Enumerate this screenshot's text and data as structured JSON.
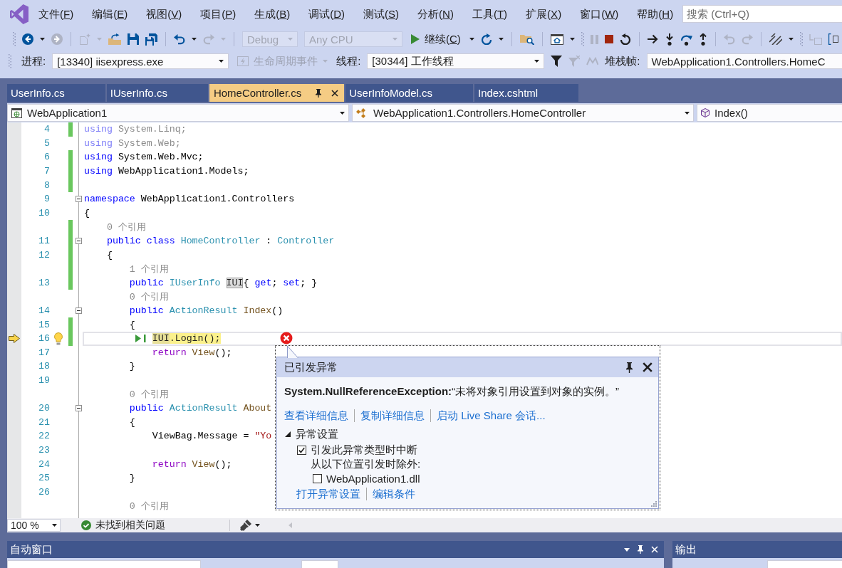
{
  "menu_bar": {
    "items": [
      {
        "prefix": "文件(",
        "access_key": "F",
        "suffix": ")"
      },
      {
        "prefix": "编辑(",
        "access_key": "E",
        "suffix": ")"
      },
      {
        "prefix": "视图(",
        "access_key": "V",
        "suffix": ")"
      },
      {
        "prefix": "项目(",
        "access_key": "P",
        "suffix": ")"
      },
      {
        "prefix": "生成(",
        "access_key": "B",
        "suffix": ")"
      },
      {
        "prefix": "调试(",
        "access_key": "D",
        "suffix": ")"
      },
      {
        "prefix": "测试(",
        "access_key": "S",
        "suffix": ")"
      },
      {
        "prefix": "分析(",
        "access_key": "N",
        "suffix": ")"
      },
      {
        "prefix": "工具(",
        "access_key": "T",
        "suffix": ")"
      },
      {
        "prefix": "扩展(",
        "access_key": "X",
        "suffix": ")"
      },
      {
        "prefix": "窗口(",
        "access_key": "W",
        "suffix": ")"
      },
      {
        "prefix": "帮助(",
        "access_key": "H",
        "suffix": ")"
      }
    ],
    "search": {
      "placeholder": "搜索 (Ctrl+Q)"
    }
  },
  "toolbar_1": {
    "items": [
      {
        "kind": "icon",
        "disabled": false
      },
      {
        "kind": "icon",
        "disabled": true
      },
      {
        "kind": "icon",
        "disabled": true
      },
      {
        "kind": "icon",
        "disabled": false
      },
      {
        "kind": "icon",
        "disabled": false
      },
      {
        "kind": "icon",
        "disabled": false
      },
      {
        "kind": "icon",
        "disabled": false
      },
      {
        "kind": "icon",
        "disabled": true
      },
      {
        "kind": "combo",
        "value": "Debug",
        "disabled": true
      },
      {
        "kind": "combo",
        "value": "Any CPU",
        "disabled": true
      },
      {
        "kind": "button",
        "prefix": "继续(",
        "access_key": "C",
        "suffix": ")"
      },
      {
        "kind": "icon",
        "disabled": false
      },
      {
        "kind": "icon",
        "disabled": false
      },
      {
        "kind": "icon",
        "disabled": false
      },
      {
        "kind": "icon",
        "disabled": true
      },
      {
        "kind": "icon",
        "disabled": false
      },
      {
        "kind": "icon",
        "disabled": false
      },
      {
        "kind": "icon",
        "disabled": false
      },
      {
        "kind": "icon",
        "disabled": false
      },
      {
        "kind": "icon",
        "disabled": false
      },
      {
        "kind": "icon",
        "disabled": false
      },
      {
        "kind": "icon",
        "disabled": true
      },
      {
        "kind": "icon",
        "disabled": true
      },
      {
        "kind": "icon",
        "disabled": false
      },
      {
        "kind": "icon",
        "disabled": true
      },
      {
        "kind": "icon",
        "disabled": false
      }
    ]
  },
  "toolbar_2": {
    "process_label": "进程:",
    "process": "[13340] iisexpress.exe",
    "lifecycle_events": {
      "label": "生命周期事件",
      "disabled": true
    },
    "thread_label": "线程:",
    "thread": "[30344] 工作线程",
    "thread_tools": [
      {
        "disabled": false
      },
      {
        "disabled": true
      },
      {
        "disabled": true
      }
    ],
    "stack_frame_label": "堆栈帧:",
    "stack_frame": "WebApplication1.Controllers.HomeC"
  },
  "tabs": [
    {
      "label": "UserInfo.cs",
      "selected": false
    },
    {
      "label": "IUserInfo.cs",
      "selected": false
    },
    {
      "label": "HomeController.cs",
      "selected": true
    },
    {
      "label": "UserInfoModel.cs",
      "selected": false
    },
    {
      "label": "Index.cshtml",
      "selected": false
    }
  ],
  "navigation_bar": {
    "project": "WebApplication1",
    "type": "WebApplication1.Controllers.HomeController",
    "member": "Index()"
  },
  "editor": {
    "lines": [
      {
        "kind": "code",
        "number": "4",
        "changed": true,
        "current": false,
        "tokens": [
          {
            "text": "using",
            "kind": "keyword_faded"
          },
          {
            "text": " System.Linq;",
            "kind": "faded"
          }
        ]
      },
      {
        "kind": "code",
        "number": "5",
        "changed": false,
        "current": false,
        "tokens": [
          {
            "text": "using",
            "kind": "keyword_faded"
          },
          {
            "text": " System.Web;",
            "kind": "faded"
          }
        ]
      },
      {
        "kind": "code",
        "number": "6",
        "changed": true,
        "current": false,
        "tokens": [
          {
            "text": "using",
            "kind": "keyword"
          },
          {
            "text": " System.Web.Mvc;",
            "kind": "plain"
          }
        ]
      },
      {
        "kind": "code",
        "number": "7",
        "changed": true,
        "current": false,
        "tokens": [
          {
            "text": "using",
            "kind": "keyword"
          },
          {
            "text": " WebApplication1.Models;",
            "kind": "plain"
          }
        ]
      },
      {
        "kind": "code",
        "number": "8",
        "changed": true,
        "current": false
      },
      {
        "kind": "code",
        "number": "9",
        "changed": false,
        "current": false,
        "expanded": true,
        "tokens": [
          {
            "text": "namespace",
            "kind": "keyword"
          },
          {
            "text": " WebApplication1.Controllers",
            "kind": "plain"
          }
        ]
      },
      {
        "kind": "code",
        "number": "10",
        "changed": false,
        "current": false,
        "tokens": [
          {
            "text": "{",
            "kind": "plain"
          }
        ]
      },
      {
        "kind": "codelens",
        "changed": true,
        "text": "    0 个引用"
      },
      {
        "kind": "code",
        "number": "11",
        "changed": true,
        "current": false,
        "expanded": true,
        "tokens": [
          {
            "text": "    public class",
            "kind": "keyword"
          },
          {
            "text": " HomeController",
            "kind": "type"
          },
          {
            "text": " : ",
            "kind": "plain"
          },
          {
            "text": "Controller",
            "kind": "type"
          }
        ]
      },
      {
        "kind": "code",
        "number": "12",
        "changed": true,
        "current": false,
        "tokens": [
          {
            "text": "    {",
            "kind": "plain"
          }
        ]
      },
      {
        "kind": "codelens",
        "changed": true,
        "text": "        1 个引用"
      },
      {
        "kind": "code",
        "number": "13",
        "changed": true,
        "current": false,
        "tokens": [
          {
            "text": "        public",
            "kind": "keyword"
          },
          {
            "text": " IUserInfo ",
            "kind": "type"
          },
          {
            "text": "IUI",
            "kind": "reference"
          },
          {
            "text": "{ ",
            "kind": "plain"
          },
          {
            "text": "get",
            "kind": "keyword"
          },
          {
            "text": "; ",
            "kind": "plain"
          },
          {
            "text": "set",
            "kind": "keyword"
          },
          {
            "text": "; }",
            "kind": "plain"
          }
        ]
      },
      {
        "kind": "codelens",
        "changed": false,
        "text": "        0 个引用"
      },
      {
        "kind": "code",
        "number": "14",
        "changed": false,
        "current": false,
        "expanded": true,
        "tokens": [
          {
            "text": "        public",
            "kind": "keyword"
          },
          {
            "text": " ActionResult",
            "kind": "type"
          },
          {
            "text": " Index",
            "kind": "method"
          },
          {
            "text": "()",
            "kind": "plain"
          }
        ]
      },
      {
        "kind": "code",
        "number": "15",
        "changed": true,
        "current": false,
        "tokens": [
          {
            "text": "        {",
            "kind": "plain"
          }
        ]
      },
      {
        "kind": "code",
        "number": "16",
        "changed": true,
        "current": true,
        "lightbulb": true,
        "run_to_click": true,
        "tokens": [
          {
            "text": "            IUI",
            "kind": "current_reference"
          },
          {
            "text": ".Login();",
            "kind": "current"
          }
        ]
      },
      {
        "kind": "code",
        "number": "17",
        "changed": false,
        "current": false,
        "tokens": [
          {
            "text": "            return",
            "kind": "control"
          },
          {
            "text": " View",
            "kind": "method"
          },
          {
            "text": "();",
            "kind": "plain"
          }
        ]
      },
      {
        "kind": "code",
        "number": "18",
        "changed": false,
        "current": false,
        "tokens": [
          {
            "text": "        }",
            "kind": "plain"
          }
        ]
      },
      {
        "kind": "code",
        "number": "19",
        "changed": false,
        "current": false
      },
      {
        "kind": "codelens",
        "changed": false,
        "text": "        0 个引用"
      },
      {
        "kind": "code",
        "number": "20",
        "changed": false,
        "current": false,
        "expanded": true,
        "tokens": [
          {
            "text": "        public",
            "kind": "keyword"
          },
          {
            "text": " ActionResult",
            "kind": "type"
          },
          {
            "text": " About",
            "kind": "method"
          }
        ]
      },
      {
        "kind": "code",
        "number": "21",
        "changed": false,
        "current": false,
        "tokens": [
          {
            "text": "        {",
            "kind": "plain"
          }
        ]
      },
      {
        "kind": "code",
        "number": "22",
        "changed": false,
        "current": false,
        "tokens": [
          {
            "text": "            ViewBag.Message = ",
            "kind": "plain"
          },
          {
            "text": "\"Yo",
            "kind": "string"
          }
        ]
      },
      {
        "kind": "code",
        "number": "23",
        "changed": false,
        "current": false
      },
      {
        "kind": "code",
        "number": "24",
        "changed": false,
        "current": false,
        "tokens": [
          {
            "text": "            return",
            "kind": "control"
          },
          {
            "text": " View",
            "kind": "method"
          },
          {
            "text": "();",
            "kind": "plain"
          }
        ]
      },
      {
        "kind": "code",
        "number": "25",
        "changed": false,
        "current": false,
        "tokens": [
          {
            "text": "        }",
            "kind": "plain"
          }
        ]
      },
      {
        "kind": "code",
        "number": "26",
        "changed": false,
        "current": false
      },
      {
        "kind": "codelens",
        "changed": false,
        "text": "        0 个引用"
      }
    ]
  },
  "exception_popup": {
    "title": "已引发异常",
    "message": "**System.NullReferenceException:**“未将对象引用设置到对象的实例。”",
    "links": [
      "查看详细信息",
      "复制详细信息",
      "启动 Live Share 会话..."
    ],
    "settings": {
      "label": "异常设置",
      "expanded": true,
      "break_when_thrown": {
        "label": "引发此异常类型时中断",
        "checked": true
      },
      "except_label": "从以下位置引发时除外:",
      "exceptions": [
        {
          "label": "WebApplication1.dll",
          "checked": false
        }
      ]
    },
    "footer_links": [
      "打开异常设置",
      "编辑条件"
    ]
  },
  "editor_status": {
    "zoom": "100 %",
    "issues": "未找到相关问题"
  },
  "panels": [
    {
      "title": "自动窗口",
      "window_buttons": true
    },
    {
      "title": "输出",
      "window_buttons": false
    }
  ]
}
